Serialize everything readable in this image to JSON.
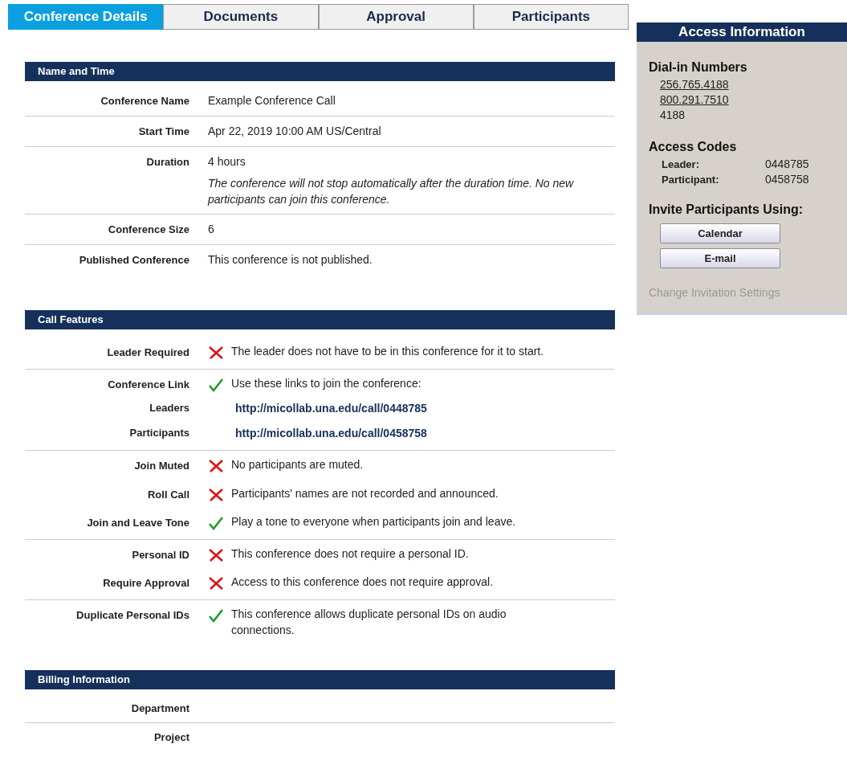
{
  "tabs": [
    {
      "label": "Conference Details",
      "selected": true
    },
    {
      "label": "Documents",
      "selected": false
    },
    {
      "label": "Approval",
      "selected": false
    },
    {
      "label": "Participants",
      "selected": false
    }
  ],
  "name_and_time": {
    "title": "Name and Time",
    "rows": [
      {
        "label": "Conference Name",
        "value": "Example Conference Call"
      },
      {
        "label": "Start Time",
        "value": "Apr 22, 2019  10:00 AM US/Central"
      },
      {
        "label": "Duration",
        "value": "4 hours",
        "note": "The conference will not stop automatically after the duration time. No new participants can join this conference."
      },
      {
        "label": "Conference Size",
        "value": "6"
      },
      {
        "label": "Published Conference",
        "value": "This conference is not published."
      }
    ]
  },
  "call_features": {
    "title": "Call Features",
    "groups": [
      [
        {
          "label": "Leader Required",
          "enabled": false,
          "text": "The leader does not have to be in this conference for it to start."
        }
      ],
      [
        {
          "label": "Conference Link",
          "enabled": true,
          "text": "Use these links to join the conference:",
          "links": [
            {
              "label": "Leaders",
              "url": "http://micollab.una.edu/call/0448785"
            },
            {
              "label": "Participants",
              "url": "http://micollab.una.edu/call/0458758"
            }
          ]
        }
      ],
      [
        {
          "label": "Join Muted",
          "enabled": false,
          "text": "No participants are muted."
        },
        {
          "label": "Roll Call",
          "enabled": false,
          "text": "Participants' names are not recorded and announced."
        },
        {
          "label": "Join and Leave Tone",
          "enabled": true,
          "text": "Play a tone to everyone when participants join and leave."
        }
      ],
      [
        {
          "label": "Personal ID",
          "enabled": false,
          "text": "This conference does not require a personal ID."
        },
        {
          "label": "Require Approval",
          "enabled": false,
          "text": "Access to this conference does not require approval."
        }
      ],
      [
        {
          "label": "Duplicate Personal IDs",
          "enabled": true,
          "text": "This conference allows duplicate personal IDs on audio connections."
        }
      ]
    ]
  },
  "billing": {
    "title": "Billing Information",
    "rows": [
      {
        "label": "Department"
      },
      {
        "label": "Project"
      }
    ]
  },
  "access_information": {
    "title": "Access Information",
    "dial_in": {
      "title": "Dial-in Numbers",
      "numbers": [
        {
          "text": "256.765.4188",
          "link": true
        },
        {
          "text": "800.291.7510",
          "link": true
        },
        {
          "text": "4188",
          "link": false
        }
      ]
    },
    "access_codes": {
      "title": "Access Codes",
      "codes": [
        {
          "label": "Leader:",
          "value": "0448785"
        },
        {
          "label": "Participant:",
          "value": "0458758"
        }
      ]
    },
    "invite": {
      "title": "Invite Participants Using:",
      "buttons": [
        "Calendar",
        "E-mail"
      ]
    },
    "settings_link": {
      "text": "Change Invitation Settings",
      "disabled": true
    }
  }
}
